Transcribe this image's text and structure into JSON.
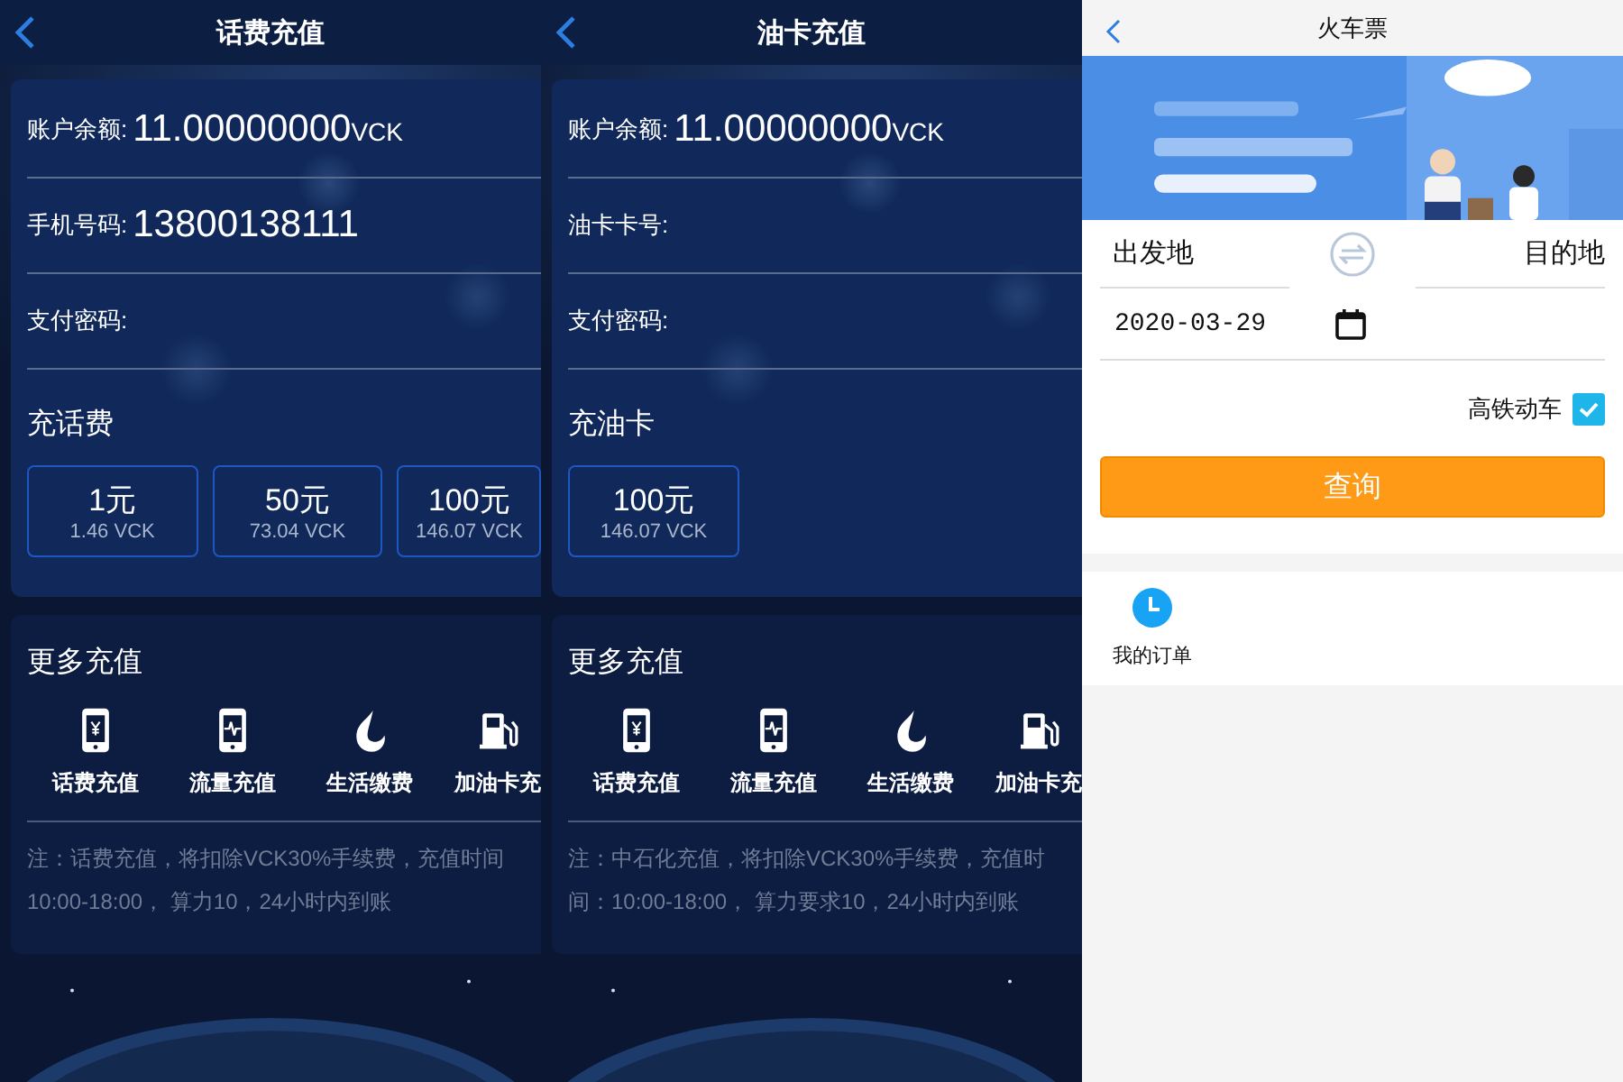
{
  "screens": [
    {
      "title": "话费充值",
      "fields": [
        {
          "label": "账户余额:",
          "value": "11.00000000",
          "unit": "VCK"
        },
        {
          "label": "手机号码:",
          "value": "13800138111"
        },
        {
          "label": "支付密码:"
        }
      ],
      "section_title": "充话费",
      "amounts": [
        {
          "price": "1元",
          "cost": "1.46 VCK"
        },
        {
          "price": "50元",
          "cost": "73.04 VCK"
        },
        {
          "price": "100元",
          "cost": "146.07 VCK"
        }
      ],
      "more": {
        "title": "更多充值",
        "items": [
          "话费充值",
          "流量充值",
          "生活缴费",
          "加油卡充"
        ],
        "note_lines": [
          "注：话费充值，将扣除VCK30%手续费，充值时间",
          "10:00-18:00， 算力10，24小时内到账"
        ]
      }
    },
    {
      "title": "油卡充值",
      "fields": [
        {
          "label": "账户余额:",
          "value": "11.00000000",
          "unit": "VCK"
        },
        {
          "label": "油卡卡号:"
        },
        {
          "label": "支付密码:"
        }
      ],
      "section_title": "充油卡",
      "amounts": [
        {
          "price": "100元",
          "cost": "146.07 VCK"
        }
      ],
      "more": {
        "title": "更多充值",
        "items": [
          "话费充值",
          "流量充值",
          "生活缴费",
          "加油卡充"
        ],
        "note_lines": [
          "注：中石化充值，将扣除VCK30%手续费，充值时",
          "间：10:00-18:00， 算力要求10，24小时内到账"
        ]
      }
    }
  ],
  "train": {
    "title": "火车票",
    "from": "出发地",
    "to": "目的地",
    "date": "2020-03-29",
    "high_speed": {
      "label": "高铁动车",
      "checked": true
    },
    "search_button": "查询",
    "orders_label": "我的订单"
  }
}
